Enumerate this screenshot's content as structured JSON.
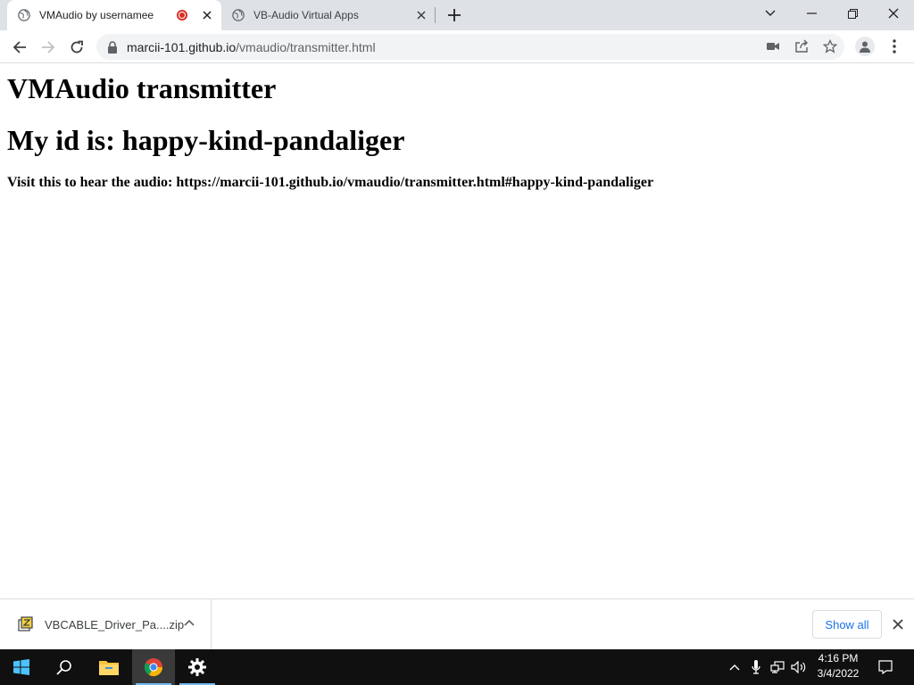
{
  "tabs": [
    {
      "title": "VMAudio by usernamee",
      "recording": true
    },
    {
      "title": "VB-Audio Virtual Apps"
    }
  ],
  "address_bar": {
    "host": "marcii-101.github.io",
    "path": "/vmaudio/transmitter.html"
  },
  "page": {
    "heading": "VMAudio transmitter",
    "id_line": "My id is: happy-kind-pandaliger",
    "visit_line": "Visit this to hear the audio: https://marcii-101.github.io/vmaudio/transmitter.html#happy-kind-pandaliger"
  },
  "download_shelf": {
    "file_name": "VBCABLE_Driver_Pa....zip",
    "show_all_label": "Show all"
  },
  "taskbar": {
    "time": "4:16 PM",
    "date": "3/4/2022",
    "pinned": [
      "windows-start-icon",
      "search-icon",
      "file-explorer-icon",
      "chrome-icon",
      "settings-icon"
    ]
  },
  "colors": {
    "accent": "#1a73e8",
    "recording": "#d93025",
    "tabstrip": "#dee1e6",
    "taskbar": "#101010"
  }
}
